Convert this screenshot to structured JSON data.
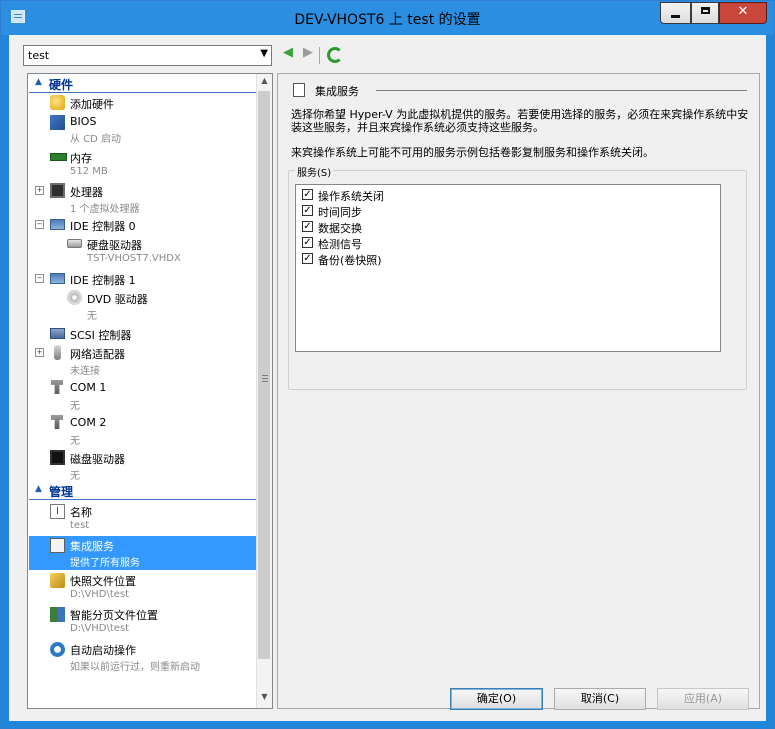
{
  "window": {
    "title": "DEV-VHOST6 上 test 的设置"
  },
  "toolbar": {
    "vm_selected": "test"
  },
  "tree": {
    "hardware_section": "硬件",
    "management_section": "管理",
    "items": [
      {
        "label": "添加硬件",
        "sub": ""
      },
      {
        "label": "BIOS",
        "sub": "从 CD 启动"
      },
      {
        "label": "内存",
        "sub": "512 MB"
      },
      {
        "label": "处理器",
        "sub": "1 个虚拟处理器"
      },
      {
        "label": "IDE 控制器 0",
        "sub": ""
      },
      {
        "label": "硬盘驱动器",
        "sub": "TST-VHOST7.VHDX"
      },
      {
        "label": "IDE 控制器 1",
        "sub": ""
      },
      {
        "label": "DVD 驱动器",
        "sub": "无"
      },
      {
        "label": "SCSI 控制器",
        "sub": ""
      },
      {
        "label": "网络适配器",
        "sub": "未连接"
      },
      {
        "label": "COM 1",
        "sub": "无"
      },
      {
        "label": "COM 2",
        "sub": "无"
      },
      {
        "label": "磁盘驱动器",
        "sub": "无"
      },
      {
        "label": "名称",
        "sub": "test"
      },
      {
        "label": "集成服务",
        "sub": "提供了所有服务"
      },
      {
        "label": "快照文件位置",
        "sub": "D:\\VHD\\test"
      },
      {
        "label": "智能分页文件位置",
        "sub": "D:\\VHD\\test"
      },
      {
        "label": "自动启动操作",
        "sub": "如果以前运行过，则重新启动"
      }
    ]
  },
  "panel": {
    "title": "集成服务",
    "desc1": "选择你希望 Hyper-V 为此虚拟机提供的服务。若要使用选择的服务，必须在来宾操作系统中安装这些服务，并且来宾操作系统必须支持这些服务。",
    "desc2": "来宾操作系统上可能不可用的服务示例包括卷影复制服务和操作系统关闭。",
    "group_label": "服务(S)",
    "services": [
      {
        "label": "操作系统关闭",
        "checked": true
      },
      {
        "label": "时间同步",
        "checked": true
      },
      {
        "label": "数据交换",
        "checked": true
      },
      {
        "label": "检测信号",
        "checked": true
      },
      {
        "label": "备份(卷快照)",
        "checked": true
      }
    ]
  },
  "buttons": {
    "ok": "确定(O)",
    "cancel": "取消(C)",
    "apply": "应用(A)"
  }
}
